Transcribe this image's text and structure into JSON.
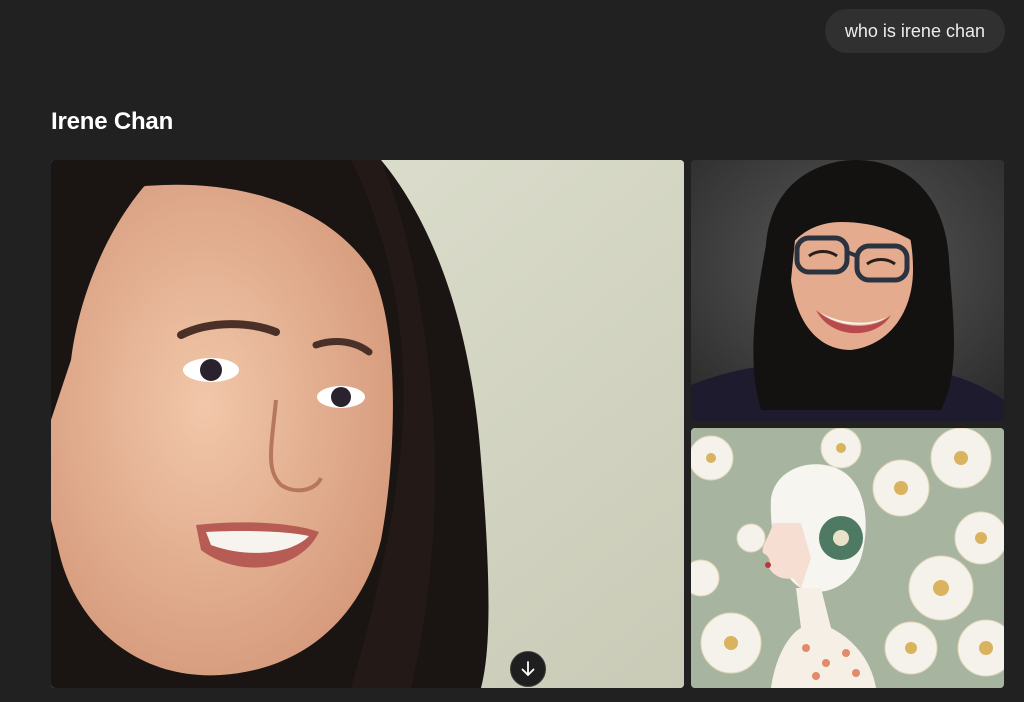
{
  "user_query": "who is irene chan",
  "section": {
    "title": "Irene Chan"
  },
  "images": [
    {
      "icon": "portrait-photo"
    },
    {
      "icon": "portrait-photo-glasses"
    },
    {
      "icon": "illustration-floral"
    }
  ],
  "scroll_button": {
    "icon": "arrow-down-icon"
  },
  "colors": {
    "background": "#212121",
    "bubble": "#303030",
    "text": "#ececec"
  }
}
